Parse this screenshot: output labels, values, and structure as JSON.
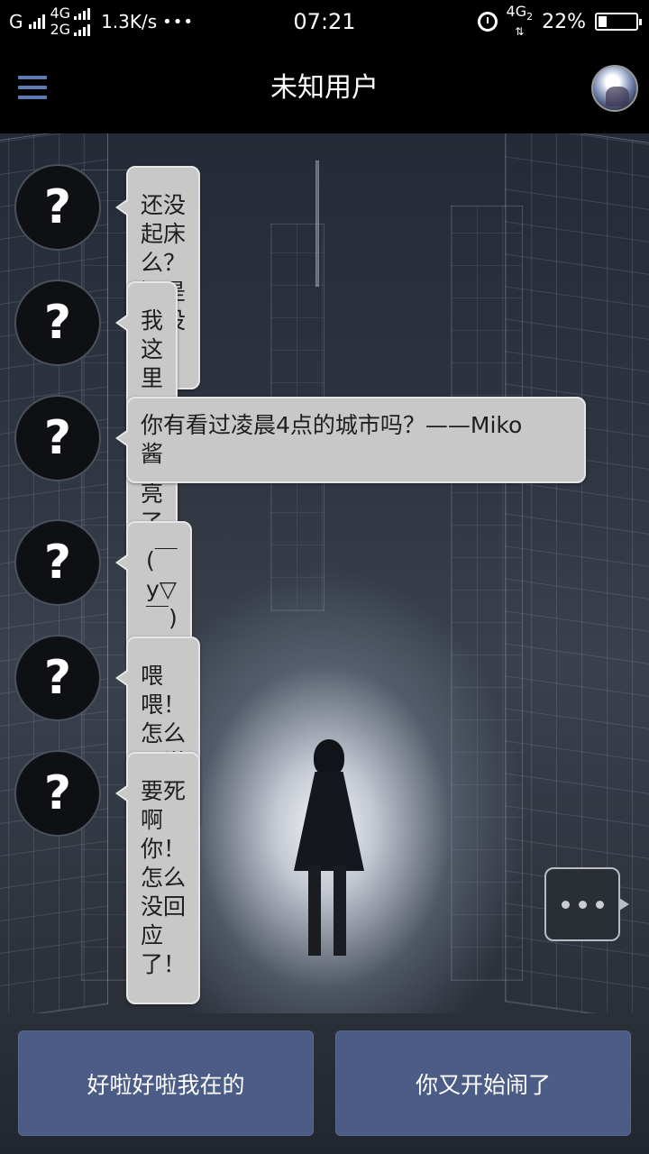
{
  "status_bar": {
    "sim1_label": "G",
    "sim_top_label": "4G",
    "sim_bottom_label": "2G",
    "speed": "1.3K/s",
    "more": "•••",
    "time": "07:21",
    "net_label": "4G",
    "net_sub": "2",
    "battery_percent": "22%",
    "battery_level": 0.22
  },
  "header": {
    "title": "未知用户"
  },
  "messages": [
    {
      "avatar": "?",
      "text": "还没起床么？还是还没睡？"
    },
    {
      "avatar": "?",
      "text": "我这里天都大亮了"
    },
    {
      "avatar": "?",
      "text_line1": "你有看过凌晨4点的城市吗？——Miko",
      "text_line2": "酱"
    },
    {
      "avatar": "?",
      "text": "(￣y▽￣)"
    },
    {
      "avatar": "?",
      "text": "喂喂！怎么不说话！"
    },
    {
      "avatar": "?",
      "text": "要死啊你！怎么没回应了！"
    }
  ],
  "replies": {
    "option1": "好啦好啦我在的",
    "option2": "你又开始闹了"
  },
  "colors": {
    "accent": "#5f7bb3",
    "reply_button": "#4b5d86",
    "bubble": "#c8c8c8"
  },
  "icons": {
    "menu": "hamburger-icon",
    "typing": "ellipsis-icon",
    "alarm": "alarm-icon",
    "battery": "battery-icon"
  }
}
